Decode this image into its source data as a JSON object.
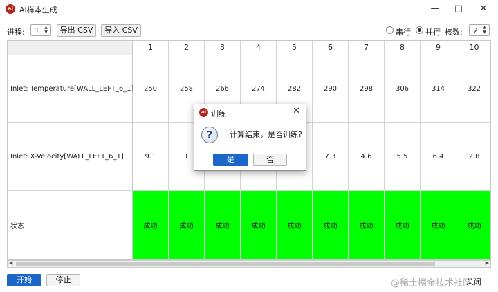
{
  "window": {
    "title": "AI样本生成",
    "icon_text": "ai"
  },
  "toolbar": {
    "process_label": "进程:",
    "process_value": "1",
    "export_csv": "导出 CSV",
    "import_csv": "导入 CSV",
    "mode_serial": "串行",
    "mode_parallel": "并行",
    "selected_mode": "并行",
    "cores_label": "核数:",
    "cores_value": "2"
  },
  "table": {
    "columns": [
      "1",
      "2",
      "3",
      "4",
      "5",
      "6",
      "7",
      "8",
      "9",
      "10"
    ],
    "rows": [
      {
        "label": "Inlet: Temperature[WALL_LEFT_6_1]",
        "cells": [
          "250",
          "258",
          "266",
          "274",
          "282",
          "290",
          "298",
          "306",
          "314",
          "322"
        ]
      },
      {
        "label": "Inlet: X-Velocity[WALL_LEFT_6_1]",
        "cells": [
          "9.1",
          "1",
          "",
          "",
          "",
          "7.3",
          "4.6",
          "5.5",
          "6.4",
          "2.8"
        ]
      },
      {
        "label": "状态",
        "cells": [
          "成功",
          "成功",
          "成功",
          "成功",
          "成功",
          "成功",
          "成功",
          "成功",
          "成功",
          "成功"
        ]
      }
    ]
  },
  "footer": {
    "start": "开始",
    "stop": "停止",
    "close": "关闭"
  },
  "dialog": {
    "title": "训练",
    "icon_text": "ai",
    "message": "计算结束，是否训练?",
    "yes": "是",
    "no": "否"
  },
  "watermark": "@稀土掘金技术社区",
  "colors": {
    "accent": "#1a66c9",
    "success": "#00ff00",
    "brand": "#b3261e"
  }
}
